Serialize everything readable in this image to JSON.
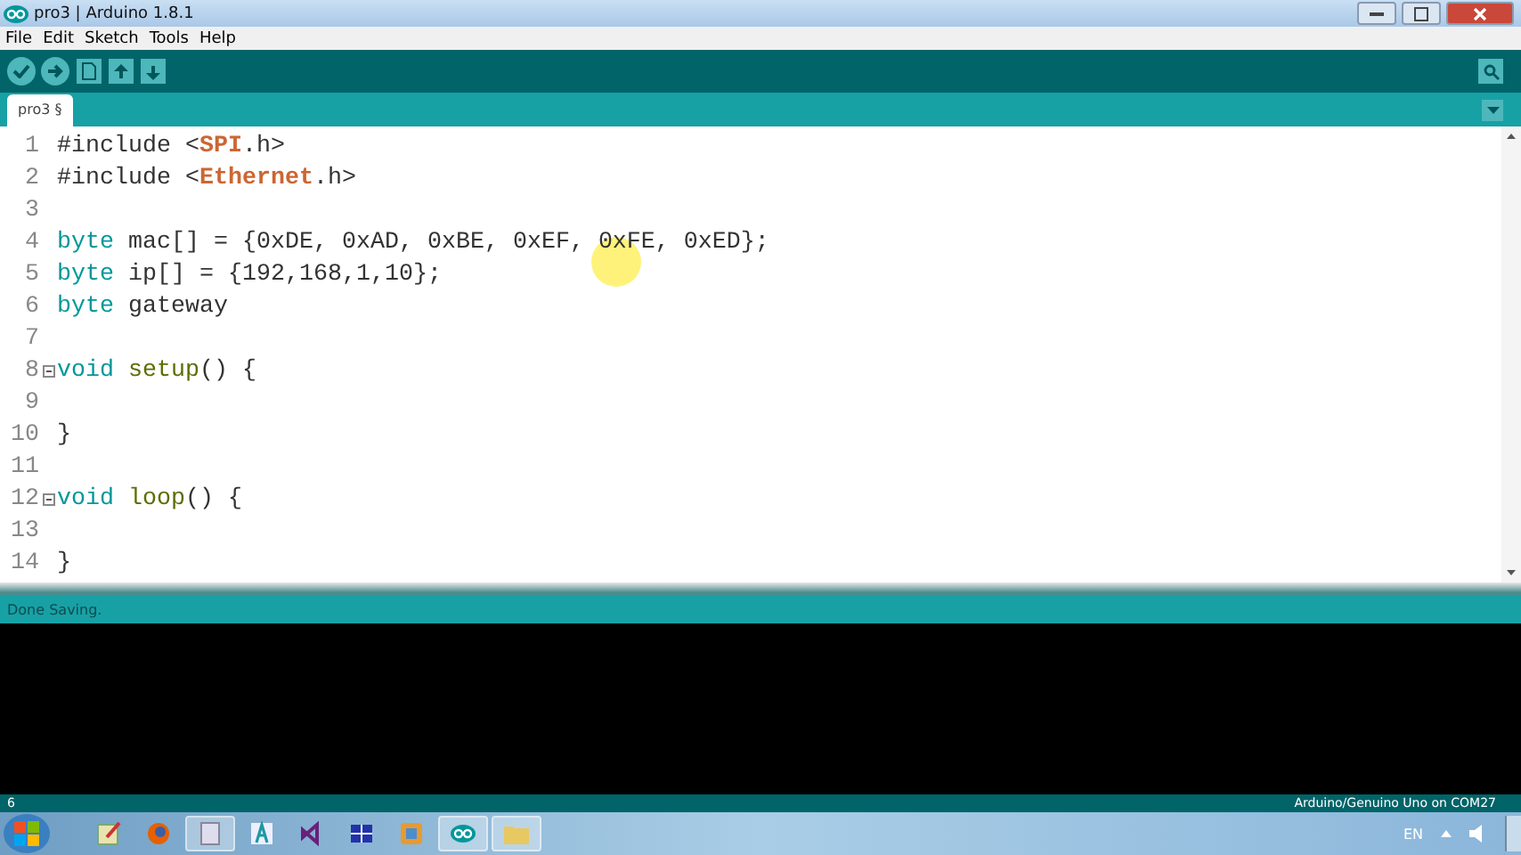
{
  "window": {
    "title": "pro3 | Arduino 1.8.1"
  },
  "menu": [
    "File",
    "Edit",
    "Sketch",
    "Tools",
    "Help"
  ],
  "tabs": [
    {
      "label": "pro3 §",
      "selected": true
    }
  ],
  "editor": {
    "lines": [
      {
        "number": "1",
        "fold": false,
        "segments": [
          {
            "text": "#include <",
            "kind": "plain"
          },
          {
            "text": "SPI",
            "kind": "library"
          },
          {
            "text": ".h>",
            "kind": "plain"
          }
        ]
      },
      {
        "number": "2",
        "fold": false,
        "segments": [
          {
            "text": "#include <",
            "kind": "plain"
          },
          {
            "text": "Ethernet",
            "kind": "library"
          },
          {
            "text": ".h>",
            "kind": "plain"
          }
        ]
      },
      {
        "number": "3",
        "fold": false
      },
      {
        "number": "4",
        "fold": false,
        "segments": [
          {
            "text": "byte",
            "kind": "type"
          },
          {
            "text": " mac[] = {0xDE, 0xAD, 0xBE, 0xEF, 0xFE, 0xED};",
            "kind": "plain"
          }
        ]
      },
      {
        "number": "5",
        "fold": false,
        "segments": [
          {
            "text": "byte",
            "kind": "type"
          },
          {
            "text": " ip[] = {192,168,1,10};",
            "kind": "plain"
          }
        ]
      },
      {
        "number": "6",
        "fold": false,
        "segments": [
          {
            "text": "byte",
            "kind": "type"
          },
          {
            "text": " gateway",
            "kind": "plain"
          }
        ]
      },
      {
        "number": "7",
        "fold": false
      },
      {
        "number": "8",
        "fold": true,
        "segments": [
          {
            "text": "void ",
            "kind": "type"
          },
          {
            "text": "setup",
            "kind": "function"
          },
          {
            "text": "() {",
            "kind": "plain"
          }
        ]
      },
      {
        "number": "9",
        "fold": false
      },
      {
        "number": "10",
        "fold": false,
        "segments": [
          {
            "text": "}",
            "kind": "plain"
          }
        ]
      },
      {
        "number": "11",
        "fold": false
      },
      {
        "number": "12",
        "fold": true,
        "segments": [
          {
            "text": "void ",
            "kind": "type"
          },
          {
            "text": "loop",
            "kind": "function"
          },
          {
            "text": "() {",
            "kind": "plain"
          }
        ]
      },
      {
        "number": "13",
        "fold": false
      },
      {
        "number": "14",
        "fold": false,
        "segments": [
          {
            "text": "}",
            "kind": "plain"
          }
        ]
      }
    ]
  },
  "status": {
    "message": "Done Saving."
  },
  "footer": {
    "line": "6",
    "board": "Arduino/Genuino Uno on COM27"
  },
  "taskbar": {
    "language": "EN"
  }
}
